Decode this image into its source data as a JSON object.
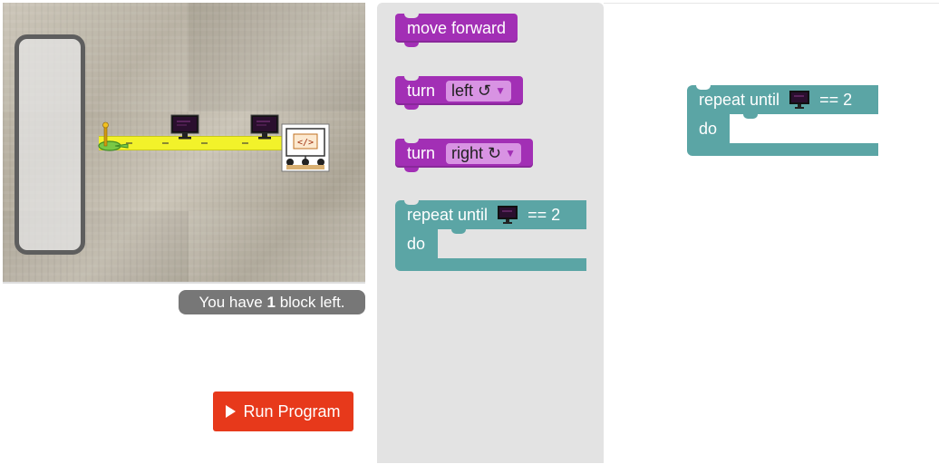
{
  "maze": {
    "obstacles": [
      "computer-icon",
      "computer-icon"
    ],
    "goal": "code-board-icon",
    "goal_label": "</>"
  },
  "status": {
    "prefix": "You have",
    "count": "1",
    "suffix": "block left."
  },
  "run_button": {
    "label": "Run Program"
  },
  "toolbox": {
    "move_forward": "move forward",
    "turn_left": {
      "label": "turn",
      "option": "left ↺"
    },
    "turn_right": {
      "label": "turn",
      "option": "right ↻"
    },
    "repeat": {
      "label": "repeat until",
      "condition": "== 2",
      "do": "do"
    }
  },
  "workspace": {
    "repeat": {
      "label": "repeat until",
      "condition": "== 2",
      "do": "do"
    }
  },
  "colors": {
    "motion_block": "#a22fb5",
    "loop_block": "#5ba5a5",
    "run_button": "#e7391b",
    "path": "#f2f22a"
  }
}
